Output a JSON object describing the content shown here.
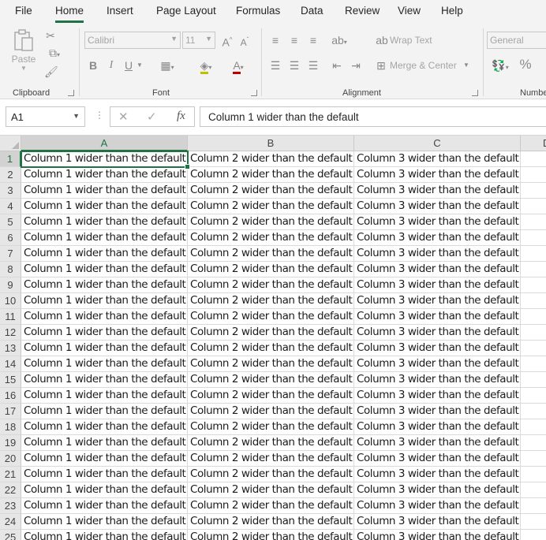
{
  "menu": {
    "tabs": [
      "File",
      "Home",
      "Insert",
      "Page Layout",
      "Formulas",
      "Data",
      "Review",
      "View",
      "Help"
    ],
    "active": "Home"
  },
  "ribbon": {
    "clipboard": {
      "label": "Clipboard",
      "paste": "Paste"
    },
    "font": {
      "label": "Font",
      "name": "Calibri",
      "size": "11",
      "bold": "B",
      "italic": "I",
      "underline": "U"
    },
    "alignment": {
      "label": "Alignment",
      "wrap_text": "Wrap Text",
      "merge_center": "Merge & Center"
    },
    "number": {
      "label": "Numbe",
      "format": "General",
      "percent": "%"
    }
  },
  "formula_bar": {
    "name_box": "A1",
    "fx": "fx",
    "value": "Column 1 wider than the default"
  },
  "sheet": {
    "columns": [
      "A",
      "B",
      "C",
      "D"
    ],
    "selected_column": "A",
    "selected_row": "1",
    "rows": [
      {
        "n": "1",
        "cells": [
          "Column 1 wider than the default",
          "Column 2 wider than the default",
          "Column 3 wider than the default",
          ""
        ]
      },
      {
        "n": "2",
        "cells": [
          "Column 1 wider than the default",
          "Column 2 wider than the default",
          "Column 3 wider than the default",
          ""
        ]
      },
      {
        "n": "3",
        "cells": [
          "Column 1 wider than the default",
          "Column 2 wider than the default",
          "Column 3 wider than the default",
          ""
        ]
      },
      {
        "n": "4",
        "cells": [
          "Column 1 wider than the default",
          "Column 2 wider than the default",
          "Column 3 wider than the default",
          ""
        ]
      },
      {
        "n": "5",
        "cells": [
          "Column 1 wider than the default",
          "Column 2 wider than the default",
          "Column 3 wider than the default",
          ""
        ]
      },
      {
        "n": "6",
        "cells": [
          "Column 1 wider than the default",
          "Column 2 wider than the default",
          "Column 3 wider than the default",
          ""
        ]
      },
      {
        "n": "7",
        "cells": [
          "Column 1 wider than the default",
          "Column 2 wider than the default",
          "Column 3 wider than the default",
          ""
        ]
      },
      {
        "n": "8",
        "cells": [
          "Column 1 wider than the default",
          "Column 2 wider than the default",
          "Column 3 wider than the default",
          ""
        ]
      },
      {
        "n": "9",
        "cells": [
          "Column 1 wider than the default",
          "Column 2 wider than the default",
          "Column 3 wider than the default",
          ""
        ]
      },
      {
        "n": "10",
        "cells": [
          "Column 1 wider than the default",
          "Column 2 wider than the default",
          "Column 3 wider than the default",
          ""
        ]
      },
      {
        "n": "11",
        "cells": [
          "Column 1 wider than the default",
          "Column 2 wider than the default",
          "Column 3 wider than the default",
          ""
        ]
      },
      {
        "n": "12",
        "cells": [
          "Column 1 wider than the default",
          "Column 2 wider than the default",
          "Column 3 wider than the default",
          ""
        ]
      },
      {
        "n": "13",
        "cells": [
          "Column 1 wider than the default",
          "Column 2 wider than the default",
          "Column 3 wider than the default",
          ""
        ]
      },
      {
        "n": "14",
        "cells": [
          "Column 1 wider than the default",
          "Column 2 wider than the default",
          "Column 3 wider than the default",
          ""
        ]
      },
      {
        "n": "15",
        "cells": [
          "Column 1 wider than the default",
          "Column 2 wider than the default",
          "Column 3 wider than the default",
          ""
        ]
      },
      {
        "n": "16",
        "cells": [
          "Column 1 wider than the default",
          "Column 2 wider than the default",
          "Column 3 wider than the default",
          ""
        ]
      },
      {
        "n": "17",
        "cells": [
          "Column 1 wider than the default",
          "Column 2 wider than the default",
          "Column 3 wider than the default",
          ""
        ]
      },
      {
        "n": "18",
        "cells": [
          "Column 1 wider than the default",
          "Column 2 wider than the default",
          "Column 3 wider than the default",
          ""
        ]
      },
      {
        "n": "19",
        "cells": [
          "Column 1 wider than the default",
          "Column 2 wider than the default",
          "Column 3 wider than the default",
          ""
        ]
      },
      {
        "n": "20",
        "cells": [
          "Column 1 wider than the default",
          "Column 2 wider than the default",
          "Column 3 wider than the default",
          ""
        ]
      },
      {
        "n": "21",
        "cells": [
          "Column 1 wider than the default",
          "Column 2 wider than the default",
          "Column 3 wider than the default",
          ""
        ]
      },
      {
        "n": "22",
        "cells": [
          "Column 1 wider than the default",
          "Column 2 wider than the default",
          "Column 3 wider than the default",
          ""
        ]
      },
      {
        "n": "23",
        "cells": [
          "Column 1 wider than the default",
          "Column 2 wider than the default",
          "Column 3 wider than the default",
          ""
        ]
      },
      {
        "n": "24",
        "cells": [
          "Column 1 wider than the default",
          "Column 2 wider than the default",
          "Column 3 wider than the default",
          ""
        ]
      },
      {
        "n": "25",
        "cells": [
          "Column 1 wider than the default",
          "Column 2 wider than the default",
          "Column 3 wider than the default",
          ""
        ]
      }
    ]
  },
  "colors": {
    "accent": "#217346",
    "ribbon_bg": "#f3f3f3",
    "header_bg": "#e6e6e6"
  }
}
